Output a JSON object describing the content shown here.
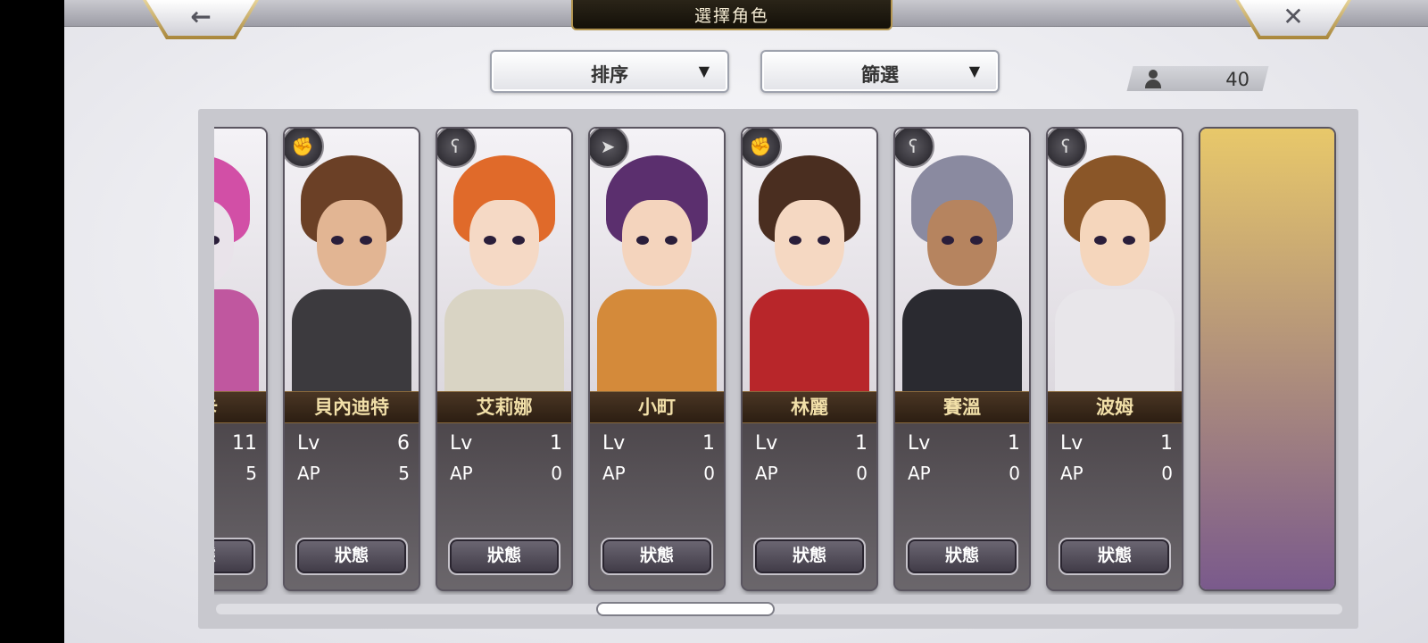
{
  "header": {
    "title": "選擇角色",
    "back_icon": "←",
    "close_icon": "✕"
  },
  "controls": {
    "sort_label": "排序",
    "filter_label": "篩選",
    "dropdown_arrow": "▼"
  },
  "count": {
    "value": "40"
  },
  "stat_labels": {
    "lv": "Lv",
    "ap": "AP"
  },
  "status_label": "狀態",
  "characters": [
    {
      "name": "莉卡",
      "lv": "11",
      "ap": "5",
      "class_icon": "✋",
      "hair": "#d24fa6",
      "skin": "#e9e3ea",
      "outfit": "#c0579f"
    },
    {
      "name": "貝內迪特",
      "lv": "6",
      "ap": "5",
      "class_icon": "✊",
      "hair": "#6b4026",
      "skin": "#e2b593",
      "outfit": "#3c3a3e"
    },
    {
      "name": "艾莉娜",
      "lv": "1",
      "ap": "0",
      "class_icon": "ʕ",
      "hair": "#e06a2a",
      "skin": "#f5d9c5",
      "outfit": "#d9d4c4"
    },
    {
      "name": "小町",
      "lv": "1",
      "ap": "0",
      "class_icon": "➤",
      "hair": "#5b2f6e",
      "skin": "#f4d4bd",
      "outfit": "#d48a3a"
    },
    {
      "name": "林麗",
      "lv": "1",
      "ap": "0",
      "class_icon": "✊",
      "hair": "#4a2e20",
      "skin": "#f5d8c2",
      "outfit": "#b8262a"
    },
    {
      "name": "賽溫",
      "lv": "1",
      "ap": "0",
      "class_icon": "ʕ",
      "hair": "#8a8aa0",
      "skin": "#b6845f",
      "outfit": "#2a2a30"
    },
    {
      "name": "波姆",
      "lv": "1",
      "ap": "0",
      "class_icon": "ʕ",
      "hair": "#8a5628",
      "skin": "#f5d6bc",
      "outfit": "#e8e6ea"
    }
  ]
}
